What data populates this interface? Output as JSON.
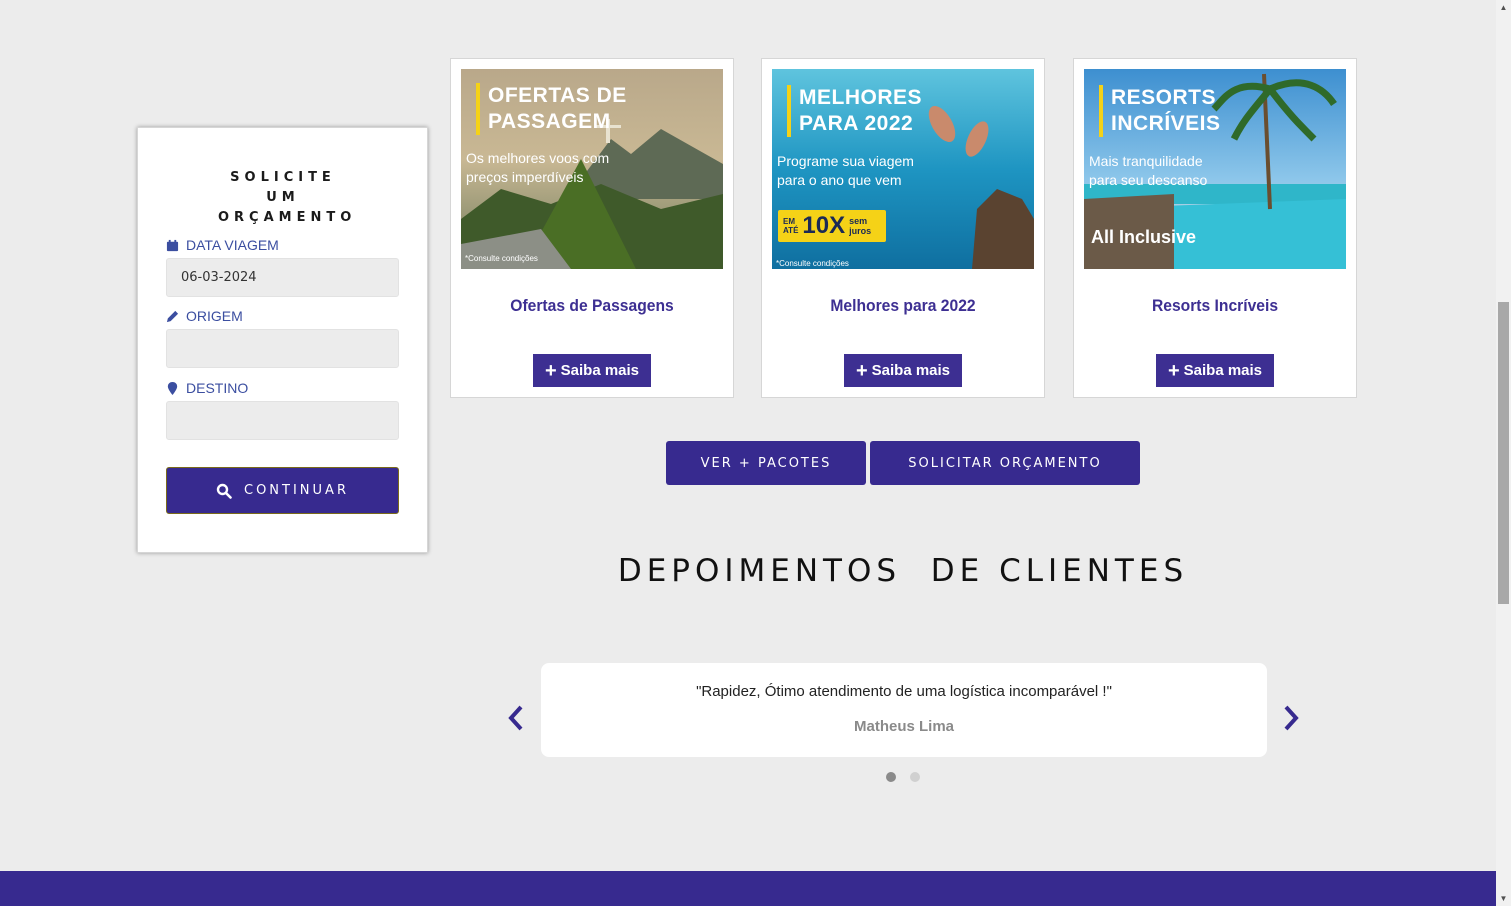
{
  "quote_form": {
    "title": "SOLICITE UM ORÇAMENTO",
    "date_label": "DATA VIAGEM",
    "date_value": "06-03-2024",
    "origin_label": "ORIGEM",
    "origin_value": "",
    "destination_label": "DESTINO",
    "destination_value": "",
    "continue_label": "CONTINUAR"
  },
  "offers": [
    {
      "title": "Ofertas de Passagens",
      "button_label": "Saiba mais",
      "image_heading_1": "OFERTAS DE",
      "image_heading_2": "PASSAGEM",
      "image_sub_1": "Os melhores voos com",
      "image_sub_2": "preços imperdíveis",
      "image_note": "*Consulte condições"
    },
    {
      "title": "Melhores para 2022",
      "button_label": "Saiba mais",
      "image_heading_1": "MELHORES",
      "image_heading_2": "PARA 2022",
      "image_sub_1": "Programe sua viagem",
      "image_sub_2": "para o ano que vem",
      "image_badge_small_1": "EM",
      "image_badge_small_2": "ATÉ",
      "image_badge_big": "10X",
      "image_badge_side_1": "sem",
      "image_badge_side_2": "juros",
      "image_note": "*Consulte condições"
    },
    {
      "title": "Resorts Incríveis",
      "button_label": "Saiba mais",
      "image_heading_1": "RESORTS",
      "image_heading_2": "INCRÍVEIS",
      "image_sub_1": "Mais tranquilidade",
      "image_sub_2": "para seu descanso",
      "image_tag": "All Inclusive"
    }
  ],
  "actions": {
    "more_packages": "VER + PACOTES",
    "request_quote": "SOLICITAR ORÇAMENTO"
  },
  "testimonials": {
    "title": "DEPOIMENTOS  DE CLIENTES",
    "current_text": "\"Rapidez, Ótimo atendimento de uma logística incomparável !\"",
    "current_author": "Matheus Lima",
    "slide_count": 2,
    "active_slide": 1
  },
  "colors": {
    "brand": "#372a8f",
    "label_blue": "#3b4ea0",
    "accent_yellow": "#f5d217"
  }
}
